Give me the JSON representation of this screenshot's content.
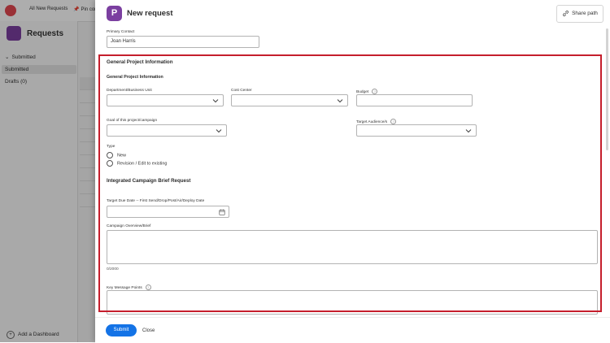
{
  "background": {
    "tabs": [
      "All New Requests",
      "Pin cont"
    ],
    "app_title": "Requests",
    "nav_items": [
      "Submitted",
      "Submitted",
      "Drafts (0)"
    ],
    "add_dashboard": "Add a Dashboard"
  },
  "panel": {
    "title": "New request",
    "share_label": "Share path"
  },
  "form": {
    "primary_contact_label": "Primary Contact",
    "primary_contact_value": "Joan Harris",
    "section_general": "General Project Information",
    "subsection_general": "General Project Information",
    "department_label": "Department/Business Unit",
    "cost_center_label": "Cost Center",
    "budget_label": "Budget",
    "goal_label": "Goal of this project/campaign",
    "target_audience_label": "Target Audience/s",
    "type_label": "Type",
    "type_options": [
      "New",
      "Revision / Edit to existing"
    ],
    "section_brief": "Integrated Campaign Brief Request",
    "target_due_label": "Target Due Date -- First Send/Drop/Post/Air/Deploy Date",
    "campaign_overview_label": "Campaign Overview/Brief",
    "campaign_overview_counter": "0/2000",
    "key_message_label": "Key Message Points"
  },
  "footer": {
    "submit_label": "Submit",
    "close_label": "Close"
  },
  "colors": {
    "brand": "#7b3fa0",
    "primary_button": "#1473e6",
    "highlight_border": "#c51e2c"
  }
}
